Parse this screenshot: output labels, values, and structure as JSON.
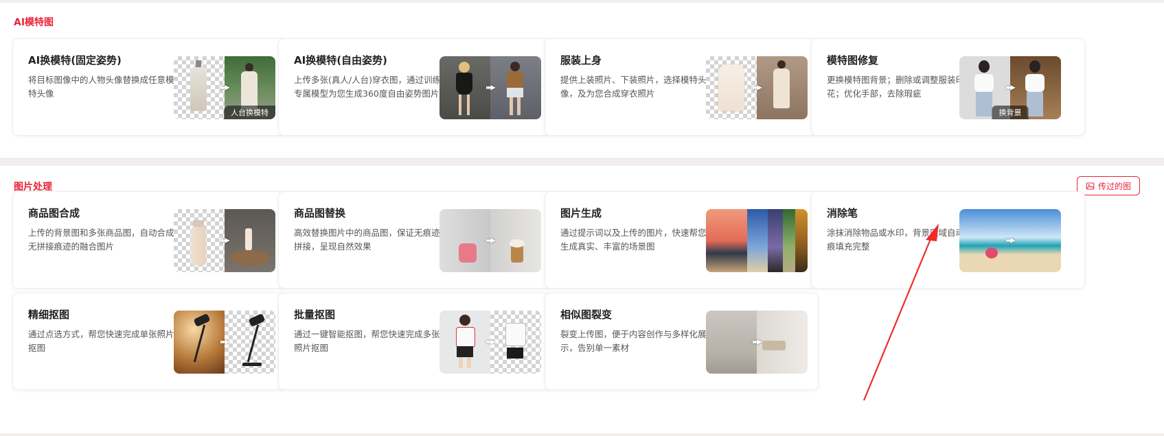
{
  "sections": {
    "ai_model": {
      "title": "AI模特图",
      "cards": [
        {
          "title": "AI换模特(固定姿势)",
          "desc": "将目标图像中的人物头像替换成任意模特头像",
          "badge": "人台换模特"
        },
        {
          "title": "AI换模特(自由姿势)",
          "desc": "上传多张(真人/人台)穿衣图，通过训练专属模型为您生成360度自由姿势图片"
        },
        {
          "title": "服装上身",
          "desc": "提供上装照片、下装照片，选择模特头像，及为您合成穿衣照片"
        },
        {
          "title": "模特图修复",
          "desc": "更换模特图背景；删除或调整服装印花；优化手部，去除瑕疵",
          "badge": "换背景"
        }
      ]
    },
    "image_processing": {
      "title": "图片处理",
      "history_button": "传过的图",
      "cards": [
        {
          "title": "商品图合成",
          "desc": "上传的背景图和多张商品图，自动合成无拼接痕迹的融合图片"
        },
        {
          "title": "商品图替换",
          "desc": "高效替换图片中的商品图，保证无痕迹拼接，呈现自然效果"
        },
        {
          "title": "图片生成",
          "desc": "通过提示词以及上传的图片，快速帮您生成真实、丰富的场景图"
        },
        {
          "title": "消除笔",
          "desc": "涂抹消除物品或水印，背景区域自动无痕填充完整"
        },
        {
          "title": "精细抠图",
          "desc": "通过点选方式，帮您快速完成单张照片抠图"
        },
        {
          "title": "批量抠图",
          "desc": "通过一键智能抠图，帮您快速完成多张照片抠图"
        },
        {
          "title": "相似图裂变",
          "desc": "裂变上传图，便于内容创作与多样化展示，告别单一素材"
        }
      ]
    }
  },
  "colors": {
    "accent": "#e8243a",
    "page_background": "#f1eeed"
  }
}
